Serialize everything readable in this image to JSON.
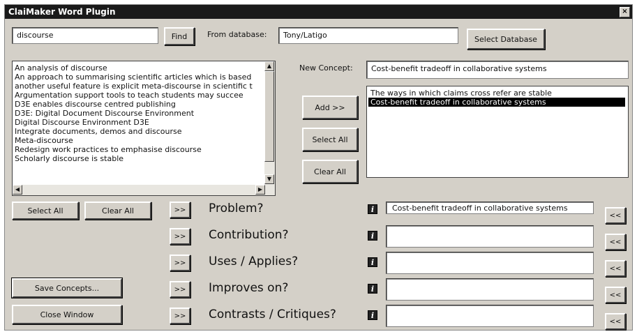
{
  "window": {
    "title": "ClaiMaker Word Plugin",
    "close_glyph": "×"
  },
  "search": {
    "value": "discourse",
    "find_label": "Find"
  },
  "database": {
    "label": "From database:",
    "value": "Tony/Latigo",
    "select_label": "Select Database"
  },
  "results": {
    "items": [
      "An analysis of discourse",
      "An approach to summarising scientific articles which is based",
      "another useful feature is explicit meta-discourse in scientific t",
      "Argumentation support tools to teach students may succee",
      "D3E enables discourse centred publishing",
      "D3E: Digital Document Discourse Environment",
      "Digital Discourse Environment D3E",
      "Integrate documents, demos and discourse",
      "Meta-discourse",
      "Redesign work practices to emphasise discourse",
      "Scholarly discourse is stable"
    ],
    "select_all_label": "Select All",
    "clear_all_label": "Clear All"
  },
  "new_concept": {
    "label": "New Concept:",
    "value": "Cost-benefit tradeoff in collaborative systems"
  },
  "actions": {
    "add_label": "Add >>",
    "select_all_label": "Select All",
    "clear_all_label": "Clear All"
  },
  "concepts": {
    "items": [
      {
        "label": "The ways in which claims cross refer are stable",
        "selected": false
      },
      {
        "label": "Cost-benefit tradeoff in collaborative systems",
        "selected": true
      }
    ]
  },
  "relations": [
    {
      "label": "Problem?",
      "value": "Cost-benefit tradeoff in collaborative systems"
    },
    {
      "label": "Contribution?",
      "value": ""
    },
    {
      "label": "Uses / Applies?",
      "value": ""
    },
    {
      "label": "Improves on?",
      "value": ""
    },
    {
      "label": "Contrasts / Critiques?",
      "value": ""
    }
  ],
  "arrows": {
    "right": ">>",
    "left": "<<"
  },
  "info_glyph": "i",
  "footer": {
    "save_label": "Save Concepts...",
    "close_label": "Close Window"
  }
}
